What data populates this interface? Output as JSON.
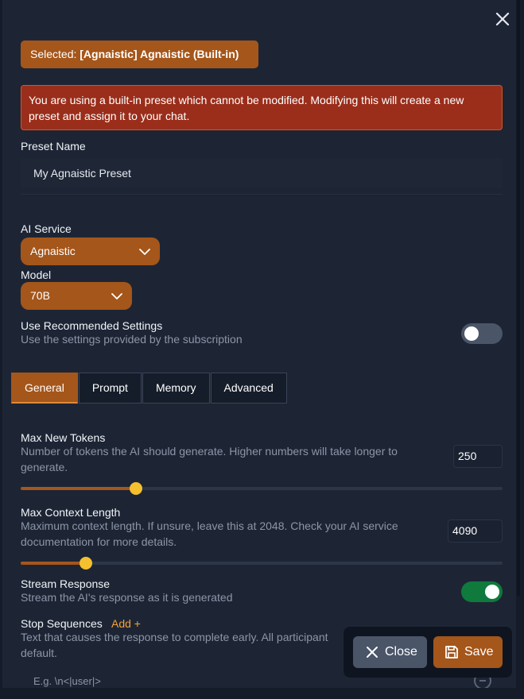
{
  "header": {
    "selected_prefix": "Selected:",
    "selected_preset": "[Agnaistic] Agnaistic (Built-in)"
  },
  "warning": {
    "text": "You are using a built-in preset which cannot be modified. Modifying this will create a new preset and assign it to your chat."
  },
  "preset_name": {
    "label": "Preset Name",
    "value": "My Agnaistic Preset"
  },
  "ai_service": {
    "label": "AI Service",
    "value": "Agnaistic"
  },
  "model": {
    "label": "Model",
    "value": "70B"
  },
  "recommended": {
    "label": "Use Recommended Settings",
    "description": "Use the settings provided by the subscription",
    "enabled": false
  },
  "tabs": [
    {
      "label": "General",
      "active": true
    },
    {
      "label": "Prompt",
      "active": false
    },
    {
      "label": "Memory",
      "active": false
    },
    {
      "label": "Advanced",
      "active": false
    }
  ],
  "max_new_tokens": {
    "label": "Max New Tokens",
    "description": "Number of tokens the AI should generate. Higher numbers will take longer to generate.",
    "value": "250",
    "slider_fraction": 0.24
  },
  "max_context_length": {
    "label": "Max Context Length",
    "description": "Maximum context length. If unsure, leave this at 2048. Check your AI service documentation for more details.",
    "value": "4090",
    "slider_fraction": 0.136
  },
  "stream_response": {
    "label": "Stream Response",
    "description": "Stream the AI's response as it is generated",
    "enabled": true
  },
  "stop_sequences": {
    "label": "Stop Sequences",
    "add_label": "Add +",
    "description_line1": "Text that causes the response to complete early. All participant",
    "description_line2": "default.",
    "placeholder": "E.g. \\n<|user|>"
  },
  "footer": {
    "close_label": "Close",
    "save_label": "Save"
  },
  "colors": {
    "accent": "#a5561a",
    "warning_bg": "#9a2e1b",
    "toggle_on": "#0f7a3c",
    "toggle_off": "#4b5568",
    "slider_thumb": "#f4c02f"
  }
}
